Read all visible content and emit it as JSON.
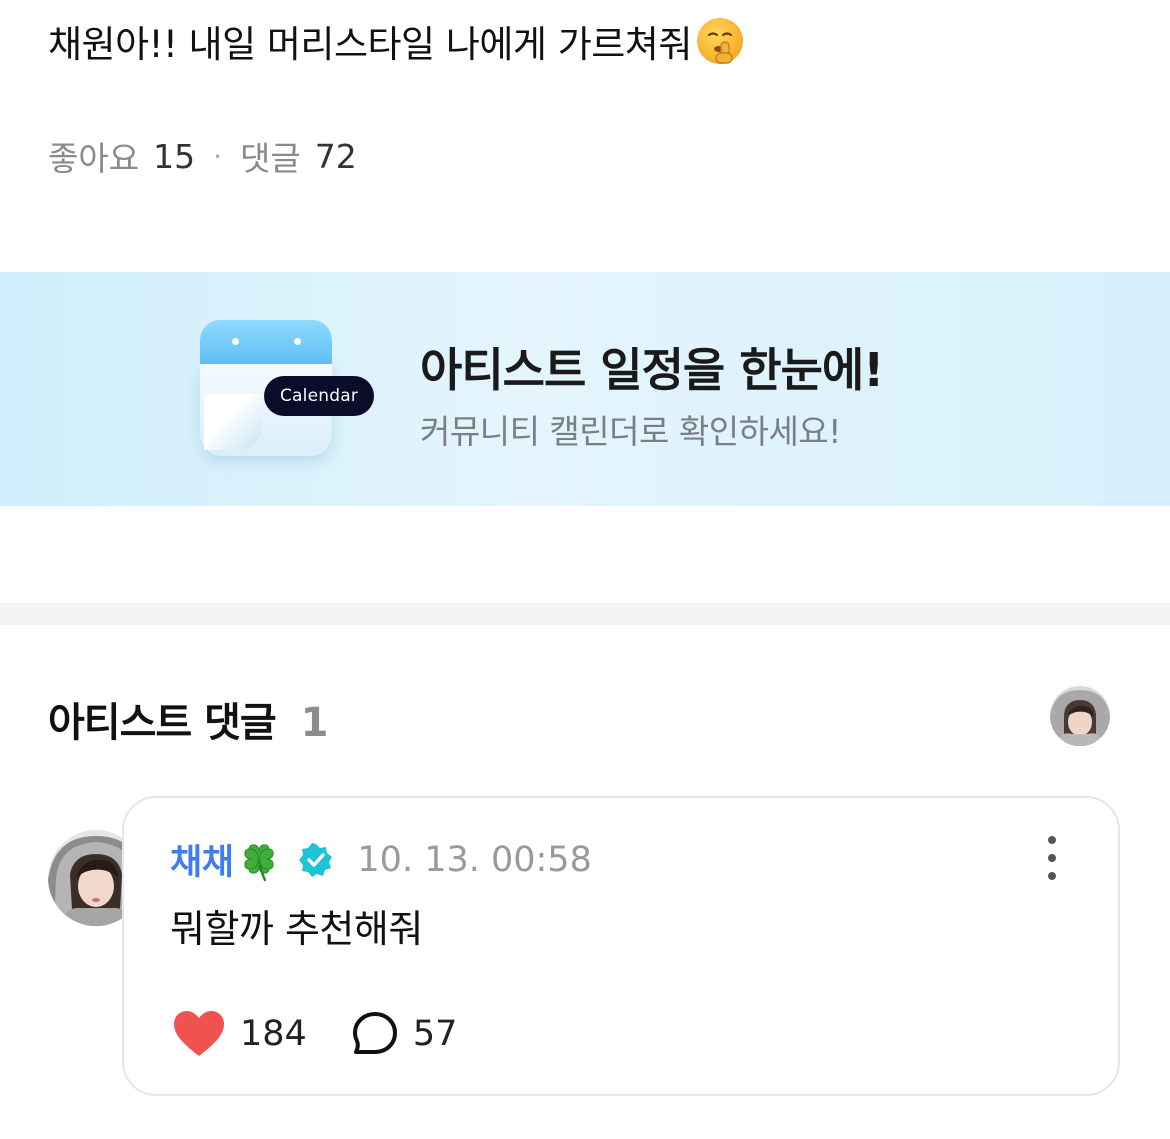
{
  "post": {
    "title": "채원아!! 내일 머리스타일 나에게 가르쳐줘",
    "title_emoji_icon": "shushing-face-emoji",
    "likes_label": "좋아요",
    "likes_count": "15",
    "comments_label": "댓글",
    "comments_count": "72"
  },
  "banner": {
    "calendar_tag": "Calendar",
    "headline": "아티스트 일정을 한눈에!",
    "subtext": "커뮤니티 캘린더로 확인하세요!",
    "icon": "calendar-icon"
  },
  "artist_comments": {
    "title": "아티스트 댓글",
    "count": "1",
    "comment": {
      "author": "채채",
      "author_emoji": "four-leaf-clover-emoji",
      "verified_icon": "verified-badge-icon",
      "time": "10. 13. 00:58",
      "text": "뭐할까 추천해줘",
      "likes": "184",
      "replies": "57",
      "like_icon": "heart-icon",
      "reply_icon": "speech-bubble-icon",
      "more_icon": "more-vertical-icon"
    }
  },
  "colors": {
    "author_name": "#3e7df0",
    "heart": "#f0534f",
    "banner_bg": "#d7f0fc",
    "verified": "#1fc3d6"
  }
}
